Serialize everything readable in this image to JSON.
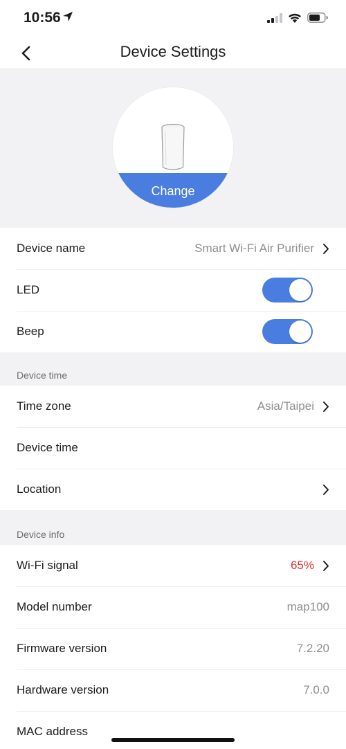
{
  "status": {
    "time": "10:56"
  },
  "nav": {
    "title": "Device Settings"
  },
  "hero": {
    "change_label": "Change"
  },
  "general": {
    "device_name_label": "Device name",
    "device_name_value": "Smart Wi-Fi Air Purifier",
    "led_label": "LED",
    "led_on": true,
    "beep_label": "Beep",
    "beep_on": true
  },
  "device_time_section": {
    "header": "Device time",
    "time_zone_label": "Time zone",
    "time_zone_value": "Asia/Taipei",
    "device_time_label": "Device time",
    "location_label": "Location"
  },
  "device_info_section": {
    "header": "Device info",
    "wifi_label": "Wi-Fi signal",
    "wifi_value": "65%",
    "model_label": "Model number",
    "model_value": "map100",
    "firmware_label": "Firmware version",
    "firmware_value": "7.2.20",
    "hardware_label": "Hardware version",
    "hardware_value": "7.0.0",
    "mac_label": "MAC address"
  },
  "colors": {
    "accent": "#4a7de0",
    "warning": "#e0322d"
  },
  "icons": [
    "location-arrow-icon",
    "cellular-signal-icon",
    "wifi-icon",
    "battery-icon",
    "back-chevron-icon",
    "device-icon",
    "chevron-right-icon"
  ]
}
